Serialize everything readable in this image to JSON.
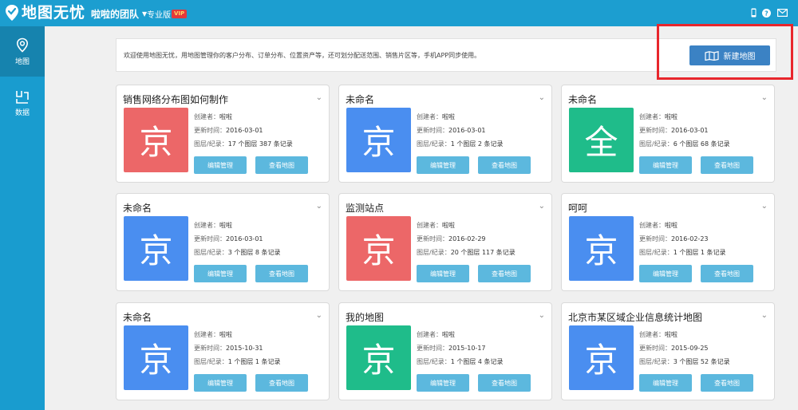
{
  "header": {
    "app_name": "地图无忧",
    "team_name": "啦啦的团队",
    "edition": "专业版",
    "vip_badge": "VIP",
    "bg_color": "#1c9ed0",
    "icons": [
      "mobile-icon",
      "help-icon",
      "mail-icon"
    ]
  },
  "sidebar": {
    "items": [
      {
        "label": "地图",
        "icon": "map-pin-icon",
        "active": true
      },
      {
        "label": "数据",
        "icon": "data-icon",
        "active": false
      }
    ]
  },
  "welcome": {
    "text": "欢迎使用地图无忧，用地图管理你的客户分布、订单分布、位置资产等，还可划分配送范围、销售片区等，手机APP同步使用。",
    "new_map_button": "新建地图"
  },
  "labels": {
    "creator": "创建者：",
    "updated": "更新时间：",
    "layers": "图层/纪录：",
    "edit_button": "编辑管理",
    "view_button": "查看地图"
  },
  "maps": [
    {
      "title": "销售网络分布图如何制作",
      "thumb_char": "京",
      "thumb_color": "#ec6768",
      "creator": "啦啦",
      "updated": "2016-03-01",
      "layers": "17 个图层 387 条记录"
    },
    {
      "title": "未命名",
      "thumb_char": "京",
      "thumb_color": "#4a8ef0",
      "creator": "啦啦",
      "updated": "2016-03-01",
      "layers": "1 个图层 2 条记录"
    },
    {
      "title": "未命名",
      "thumb_char": "全",
      "thumb_color": "#1fbc8a",
      "creator": "啦啦",
      "updated": "2016-03-01",
      "layers": "6 个图层 68 条记录"
    },
    {
      "title": "未命名",
      "thumb_char": "京",
      "thumb_color": "#4a8ef0",
      "creator": "啦啦",
      "updated": "2016-03-01",
      "layers": "3 个图层 8 条记录"
    },
    {
      "title": "监测站点",
      "thumb_char": "京",
      "thumb_color": "#ec6768",
      "creator": "啦啦",
      "updated": "2016-02-29",
      "layers": "20 个图层 117 条记录"
    },
    {
      "title": "呵呵",
      "thumb_char": "京",
      "thumb_color": "#4a8ef0",
      "creator": "啦啦",
      "updated": "2016-02-23",
      "layers": "1 个图层 1 条记录"
    },
    {
      "title": "未命名",
      "thumb_char": "京",
      "thumb_color": "#4a8ef0",
      "creator": "啦啦",
      "updated": "2015-10-31",
      "layers": "1 个图层 1 条记录"
    },
    {
      "title": "我的地图",
      "thumb_char": "京",
      "thumb_color": "#1fbc8a",
      "creator": "啦啦",
      "updated": "2015-10-17",
      "layers": "1 个图层 4 条记录"
    },
    {
      "title": "北京市某区域企业信息统计地图",
      "thumb_char": "京",
      "thumb_color": "#4a8ef0",
      "creator": "啦啦",
      "updated": "2015-09-25",
      "layers": "3 个图层 52 条记录"
    }
  ]
}
